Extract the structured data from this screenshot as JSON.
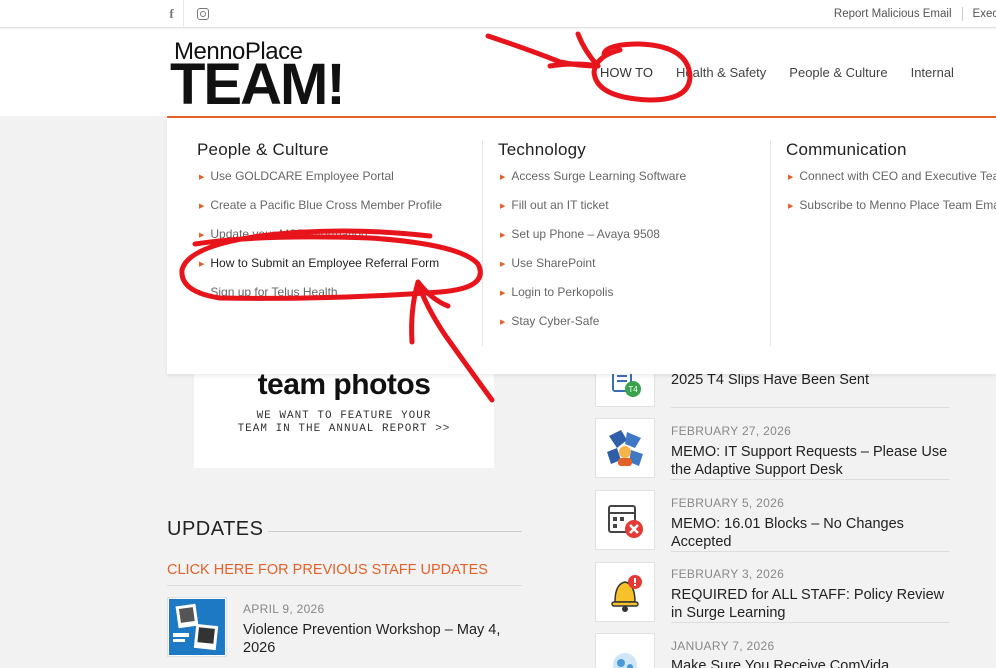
{
  "topbar": {
    "facebook_glyph": "f",
    "links": [
      "Report Malicious Email",
      "Exec Co"
    ]
  },
  "logo": {
    "line1": "MennoPlace",
    "line2": "TEAM!"
  },
  "nav": {
    "items": [
      "HOW TO",
      "Health & Safety",
      "People & Culture",
      "Internal"
    ]
  },
  "mega_menu": {
    "columns": [
      {
        "heading": "People & Culture",
        "items": [
          "Use GOLDCARE Employee Portal",
          "Create a Pacific Blue Cross Member Profile",
          "Update your MSP information",
          "How to Submit an Employee Referral Form",
          "Sign up for Telus Health"
        ]
      },
      {
        "heading": "Technology",
        "items": [
          "Access Surge Learning Software",
          "Fill out an IT ticket",
          "Set up Phone – Avaya 9508",
          "Use SharePoint",
          "Login to Perkopolis",
          "Stay Cyber-Safe"
        ]
      },
      {
        "heading": "Communication",
        "items": [
          "Connect with CEO and Executive Team",
          "Subscribe to Menno Place Team Emails"
        ]
      }
    ]
  },
  "promo": {
    "headline": "team photos",
    "line1": "WE WANT TO FEATURE YOUR",
    "line2": "TEAM IN THE ANNUAL REPORT >>"
  },
  "updates": {
    "title": "UPDATES",
    "previous_link": "CLICK HERE FOR PREVIOUS STAFF UPDATES",
    "items": [
      {
        "date": "APRIL 9, 2026",
        "title": "Violence Prevention Workshop – May 4, 2026"
      }
    ]
  },
  "news": {
    "items": [
      {
        "date": "",
        "title": "2025 T4 Slips Have Been Sent",
        "icon": "t4-document-icon"
      },
      {
        "date": "FEBRUARY 27, 2026",
        "title": "MEMO: IT Support Requests – Please Use the Adaptive Support Desk",
        "icon": "it-support-icon"
      },
      {
        "date": "FEBRUARY 5, 2026",
        "title": "MEMO: 16.01 Blocks – No Changes Accepted",
        "icon": "calendar-x-icon"
      },
      {
        "date": "FEBRUARY 3, 2026",
        "title": "REQUIRED for ALL STAFF: Policy Review in Surge Learning",
        "icon": "alert-bell-icon"
      },
      {
        "date": "JANUARY 7, 2026",
        "title": "Make Sure You Receive ComVida",
        "icon": "comvida-icon"
      }
    ]
  },
  "colors": {
    "accent": "#e1622a",
    "annotation": "#e8141c"
  }
}
